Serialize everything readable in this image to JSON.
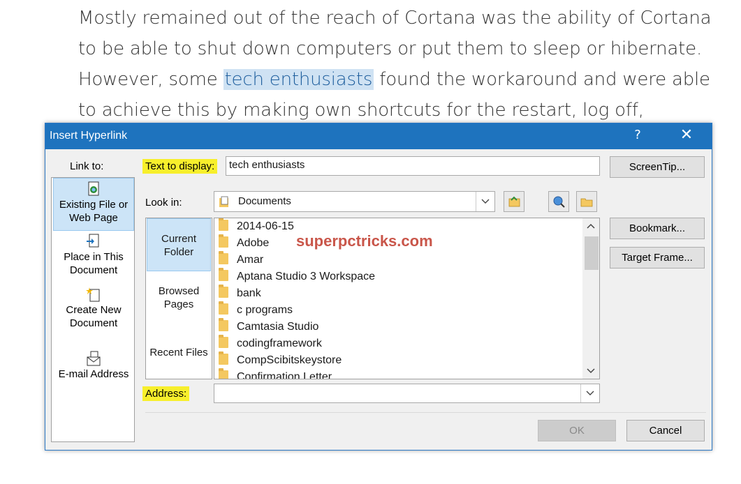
{
  "document": {
    "lines": [
      "Mostly remained out of the reach of Cortana was the ability of Cortana",
      "to be able to shut down computers or put them to sleep or hibernate.",
      "However, some ",
      " found the workaround and were able",
      "to achieve this by making own shortcuts for the restart, log off,"
    ],
    "selected_text": "tech enthusiasts"
  },
  "dialog": {
    "title": "Insert Hyperlink",
    "help": "?",
    "close": "✕",
    "link_to_label": "Link to:",
    "link_to_items": [
      {
        "label": "Existing File or Web Page",
        "icon": "existing-file-icon"
      },
      {
        "label": "Place in This Document",
        "icon": "place-in-document-icon"
      },
      {
        "label": "Create New Document",
        "icon": "new-document-icon"
      },
      {
        "label": "E-mail Address",
        "icon": "email-icon"
      }
    ],
    "text_to_display_label": "Text to display:",
    "text_to_display_value": "tech enthusiasts",
    "screentip_label": "ScreenTip...",
    "look_in_label": "Look in:",
    "look_in_value": "Documents",
    "bookmark_label": "Bookmark...",
    "target_frame_label": "Target Frame...",
    "side_tabs": [
      "Current Folder",
      "Browsed Pages",
      "Recent Files"
    ],
    "files": [
      "2014-06-15",
      "Adobe",
      "Amar",
      "Aptana Studio 3 Workspace",
      "bank",
      "c programs",
      "Camtasia Studio",
      "codingframework",
      "CompScibitskeystore",
      "Confirmation Letter"
    ],
    "watermark": "superpctricks.com",
    "address_label": "Address:",
    "address_value": "",
    "ok_label": "OK",
    "cancel_label": "Cancel"
  },
  "colors": {
    "titlebar": "#1e73be",
    "highlight": "#f7ef2c",
    "selection": "#cce4f7"
  }
}
